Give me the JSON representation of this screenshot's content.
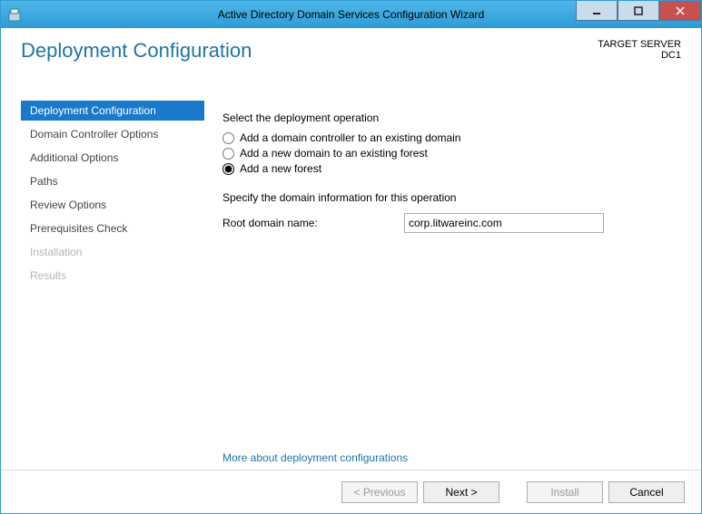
{
  "window": {
    "title": "Active Directory Domain Services Configuration Wizard"
  },
  "header": {
    "page_title": "Deployment Configuration",
    "target_server_label": "TARGET SERVER",
    "target_server_value": "DC1"
  },
  "sidebar": {
    "steps": [
      {
        "label": "Deployment Configuration",
        "state": "active"
      },
      {
        "label": "Domain Controller Options",
        "state": "normal"
      },
      {
        "label": "Additional Options",
        "state": "normal"
      },
      {
        "label": "Paths",
        "state": "normal"
      },
      {
        "label": "Review Options",
        "state": "normal"
      },
      {
        "label": "Prerequisites Check",
        "state": "normal"
      },
      {
        "label": "Installation",
        "state": "disabled"
      },
      {
        "label": "Results",
        "state": "disabled"
      }
    ]
  },
  "main": {
    "operation_label": "Select the deployment operation",
    "radios": [
      {
        "label": "Add a domain controller to an existing domain",
        "checked": false
      },
      {
        "label": "Add a new domain to an existing forest",
        "checked": false
      },
      {
        "label": "Add a new forest",
        "checked": true
      }
    ],
    "specify_label": "Specify the domain information for this operation",
    "root_domain_label": "Root domain name:",
    "root_domain_value": "corp.litwareinc.com",
    "help_link": "More about deployment configurations"
  },
  "buttons": {
    "previous": "< Previous",
    "next": "Next >",
    "install": "Install",
    "cancel": "Cancel"
  }
}
